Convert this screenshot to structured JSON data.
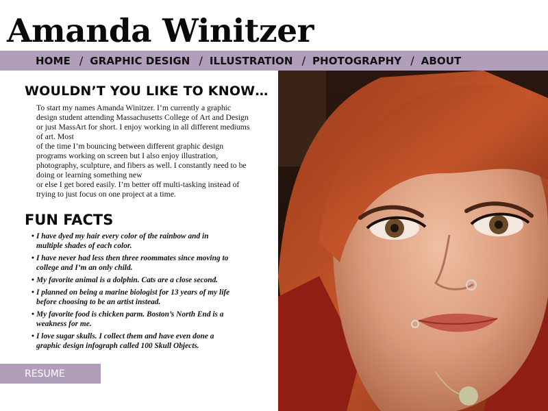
{
  "site": {
    "title": "Amanda Winitzer"
  },
  "nav": {
    "items": [
      {
        "label": "HOME"
      },
      {
        "label": "GRAPHIC DESIGN"
      },
      {
        "label": "ILLUSTRATION"
      },
      {
        "label": "PHOTOGRAPHY"
      },
      {
        "label": "ABOUT"
      }
    ],
    "separator": "/"
  },
  "about": {
    "heading": "WOULDN’T YOU LIKE TO KNOW…",
    "lines": [
      "To start my names Amanda Winitzer. I’m currently a graphic",
      "design student attending Massachusetts College of Art and Design",
      "or just MassArt for short. I enjoy working in all different mediums",
      "of art. Most",
      "of the time I’m bouncing between different graphic design",
      "programs working on screen but I also enjoy illustration,",
      "photography, sculpture, and fibers as well. I constantly need to be",
      "doing or learning something new",
      "or else I get bored easily. I’m better off multi-tasking instead of",
      "trying to just focus on one project at a time."
    ]
  },
  "facts": {
    "heading": "FUN FACTS",
    "bullet": "•",
    "items": [
      {
        "lines": [
          "I have dyed my hair every color of the rainbow and in",
          "multiple shades of each color."
        ]
      },
      {
        "lines": [
          "I have never had less then three roommates since moving to",
          "college and I’m an only child."
        ]
      },
      {
        "lines": [
          "My favorite animal is a dolphin. Cats are a close second."
        ]
      },
      {
        "lines": [
          "I planned on being a marine biologist for 13 years of my life",
          "before choosing to be an artist instead."
        ]
      },
      {
        "lines": [
          "My favorite food is chicken parm. Boston’s North End is a",
          "weakness for me."
        ]
      },
      {
        "lines": [
          "I love sugar skulls. I collect them and have even done a",
          "graphic design infograph called 100 Skull Objects."
        ]
      }
    ]
  },
  "resume": {
    "label": "RESUME"
  },
  "colors": {
    "accent": "#b09ebb",
    "text": "#111111",
    "background": "#ffffff"
  },
  "portrait": {
    "icon": "portrait-photo"
  }
}
